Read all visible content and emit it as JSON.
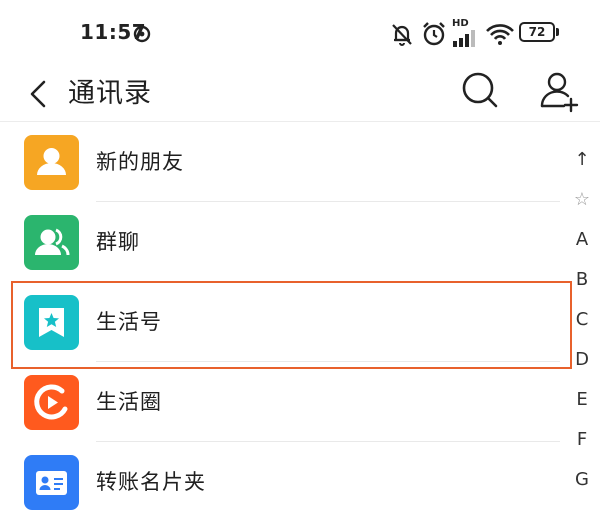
{
  "status_bar": {
    "time": "11:57",
    "battery": "72",
    "network_label": "HD"
  },
  "header": {
    "title": "通讯录"
  },
  "list": {
    "items": [
      {
        "label": "新的朋友",
        "color": "#F6A623",
        "icon": "person-icon"
      },
      {
        "label": "群聊",
        "color": "#2BB56E",
        "icon": "group-icon"
      },
      {
        "label": "生活号",
        "color": "#17C0C8",
        "icon": "bookmark-star-icon"
      },
      {
        "label": "生活圈",
        "color": "#FF5A1E",
        "icon": "circle-play-icon"
      },
      {
        "label": "转账名片夹",
        "color": "#2F7CF6",
        "icon": "card-icon"
      }
    ]
  },
  "index_bar": {
    "letters": [
      "↑",
      "☆",
      "A",
      "B",
      "C",
      "D",
      "E",
      "F",
      "G"
    ]
  },
  "colors": {
    "highlight": "#E8612C"
  }
}
